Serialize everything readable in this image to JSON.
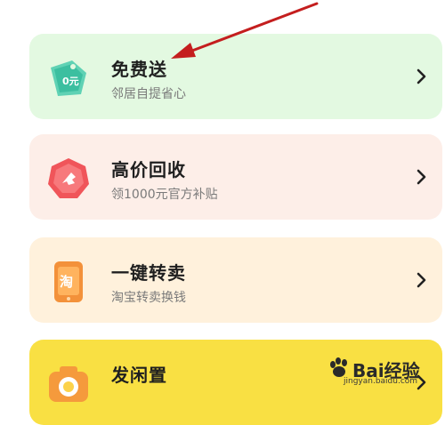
{
  "cards": [
    {
      "title": "免费送",
      "subtitle": "邻居自提省心",
      "icon": "free-tag-icon",
      "icon_label": "0元"
    },
    {
      "title": "高价回收",
      "subtitle": "领1000元官方补贴",
      "icon": "recycle-badge-icon"
    },
    {
      "title": "一键转卖",
      "subtitle": "淘宝转卖换钱",
      "icon": "taobao-phone-icon",
      "icon_label": "淘"
    },
    {
      "title": "发闲置",
      "subtitle": "",
      "icon": "camera-icon"
    }
  ],
  "watermark": {
    "brand": "Bai经验",
    "url": "jingyan.baidu.com"
  },
  "colors": {
    "card1": "#e3f9e1",
    "card2": "#fdeee8",
    "card3": "#fff1dc",
    "card4": "#f9e043",
    "arrow": "#c41e1e"
  }
}
